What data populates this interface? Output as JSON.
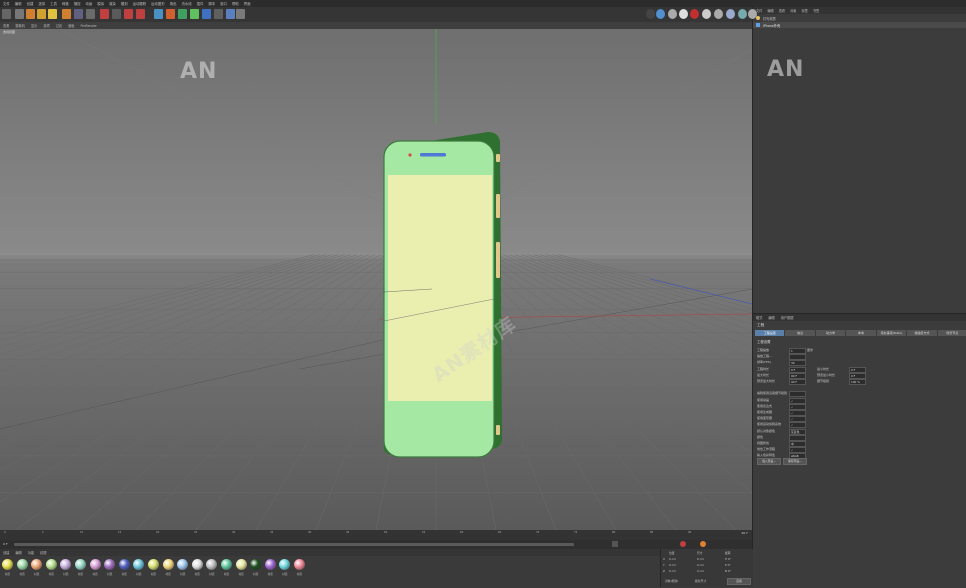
{
  "menu": [
    "文件",
    "编辑",
    "创建",
    "选择",
    "工具",
    "网格",
    "捕捉",
    "动画",
    "模拟",
    "渲染",
    "雕刻",
    "运动跟踪",
    "运动图形",
    "角色",
    "流水线",
    "插件",
    "脚本",
    "窗口",
    "帮助",
    "界面"
  ],
  "viewport_menu": [
    "查看",
    "摄像机",
    "显示",
    "选项",
    "过滤",
    "面板",
    "ProRender"
  ],
  "viewport_label": "透视视图",
  "watermark_logo": "AN",
  "watermark_text": "AN素材库",
  "object_manager": {
    "menu": [
      "文件",
      "编辑",
      "查看",
      "对象",
      "标签",
      "书签"
    ],
    "rows": [
      {
        "name": "灯光材质",
        "icon": "light-icon"
      },
      {
        "name": "iPhone外壳",
        "icon": "object-icon"
      }
    ]
  },
  "attributes": {
    "menu": [
      "模式",
      "编辑",
      "用户数据"
    ],
    "title": "工程",
    "tabs": [
      "工程设置",
      "信息",
      "动力学",
      "参考",
      "待办事项(ToDo)",
      "帧插值方式",
      "场景节点"
    ],
    "active_tab": 0,
    "section": "工程设置",
    "fields": [
      {
        "label": "工程缩放",
        "value": "1",
        "unit": "厘米"
      },
      {
        "label": "缩放工程...",
        "value": ""
      },
      {
        "label": "帧率(FPS)",
        "value": "30"
      },
      {
        "label": "工程时长",
        "value": "0 F"
      },
      {
        "label": "最小时长",
        "value": "0 F"
      },
      {
        "label": "最大时长",
        "value": "90 F"
      },
      {
        "label": "预览最小时长",
        "value": "0 F"
      },
      {
        "label": "预览最大时长",
        "value": "90 F"
      },
      {
        "label": "细节级别",
        "value": "100 %"
      },
      {
        "label": "编辑使用渲染细节级别",
        "value": ""
      },
      {
        "label": "使用动画",
        "value": "✓"
      },
      {
        "label": "使用表达式",
        "value": "✓"
      },
      {
        "label": "使用生成器",
        "value": "✓"
      },
      {
        "label": "使用变形器",
        "value": "✓"
      },
      {
        "label": "使用运动剪辑系统",
        "value": "✓"
      },
      {
        "label": "默认对象颜色",
        "value": "灰蓝色"
      },
      {
        "label": "颜色",
        "value": ""
      },
      {
        "label": "视图修剪",
        "value": "中"
      },
      {
        "label": "线性工作流程",
        "value": "✓"
      },
      {
        "label": "输入色彩特性",
        "value": "sRGB"
      }
    ],
    "buttons": [
      "载入预设...",
      "保存预设..."
    ]
  },
  "timeline": {
    "ticks": [
      "0",
      "5",
      "10",
      "15",
      "20",
      "25",
      "30",
      "35",
      "40",
      "45",
      "50",
      "55",
      "60",
      "65",
      "70",
      "75",
      "80",
      "85",
      "90"
    ],
    "current": "0 F",
    "end": "90 F"
  },
  "material_manager": {
    "menu": [
      "创建",
      "编辑",
      "功能",
      "纹理"
    ],
    "materials": [
      {
        "name": "材质",
        "color": "#e8e050"
      },
      {
        "name": "材质",
        "color": "#9ed8a8"
      },
      {
        "name": "材质",
        "color": "#f0a878"
      },
      {
        "name": "材质",
        "color": "#b8e090"
      },
      {
        "name": "材质",
        "color": "#c8b0e0"
      },
      {
        "name": "材质",
        "color": "#98d8c8"
      },
      {
        "name": "材质",
        "color": "#d8a0d8"
      },
      {
        "name": "材质",
        "color": "#a070c0"
      },
      {
        "name": "材质",
        "color": "#5060c0"
      },
      {
        "name": "材质",
        "color": "#70c8e0"
      },
      {
        "name": "材质",
        "color": "#d8e070"
      },
      {
        "name": "材质",
        "color": "#f0d880"
      },
      {
        "name": "材质",
        "color": "#a0c8f0"
      },
      {
        "name": "材质",
        "color": "#e0e0e0"
      },
      {
        "name": "材质",
        "color": "#c0c0c0"
      },
      {
        "name": "材质",
        "color": "#60c8a0"
      },
      {
        "name": "材质",
        "color": "#e8e8a0"
      },
      {
        "name": "材质",
        "color": "#205020"
      },
      {
        "name": "材质",
        "color": "#a068d0"
      },
      {
        "name": "材质",
        "color": "#70d8e0"
      },
      {
        "name": "材质",
        "color": "#f08898"
      }
    ]
  },
  "coordinates": {
    "labels": [
      "位置",
      "尺寸",
      "旋转"
    ],
    "rows": [
      {
        "axis": "X",
        "pos": "0 cm",
        "size": "0 cm",
        "rot": "H 0°"
      },
      {
        "axis": "Y",
        "pos": "0 cm",
        "size": "0 cm",
        "rot": "P 0°"
      },
      {
        "axis": "Z",
        "pos": "0 cm",
        "size": "0 cm",
        "rot": "B 0°"
      }
    ],
    "mode": "对象(相对)",
    "size_mode": "绝对尺寸",
    "apply": "应用"
  }
}
